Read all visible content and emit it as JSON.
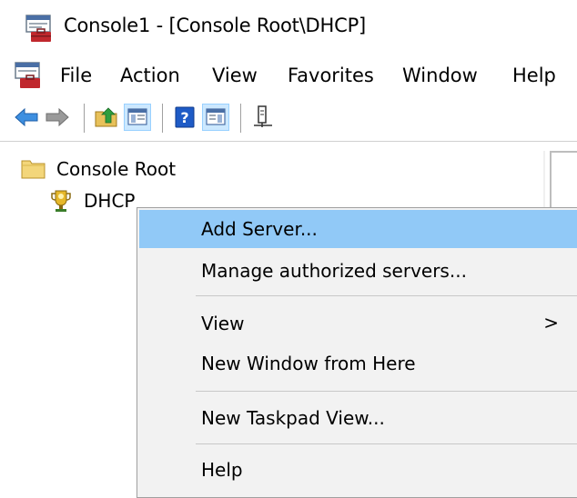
{
  "window": {
    "title": "Console1 - [Console Root\\DHCP]"
  },
  "menubar": {
    "items": [
      "File",
      "Action",
      "View",
      "Favorites",
      "Window",
      "Help"
    ]
  },
  "toolbar": {
    "buttons": [
      "back-arrow-icon",
      "forward-arrow-icon",
      "up-folder-icon",
      "show-hide-console-tree-icon",
      "help-icon",
      "show-hide-action-pane-icon",
      "export-list-icon"
    ]
  },
  "tree": {
    "root": "Console Root",
    "child": "DHCP"
  },
  "context_menu": {
    "add_server": "Add Server...",
    "manage_authorized": "Manage authorized servers...",
    "view": "View",
    "view_arrow": ">",
    "new_window": "New Window from Here",
    "new_taskpad": "New Taskpad View...",
    "help": "Help"
  },
  "colors": {
    "highlight": "#91c9f7",
    "menu_bg": "#f2f2f2",
    "pressed_button": "#cce8ff"
  }
}
